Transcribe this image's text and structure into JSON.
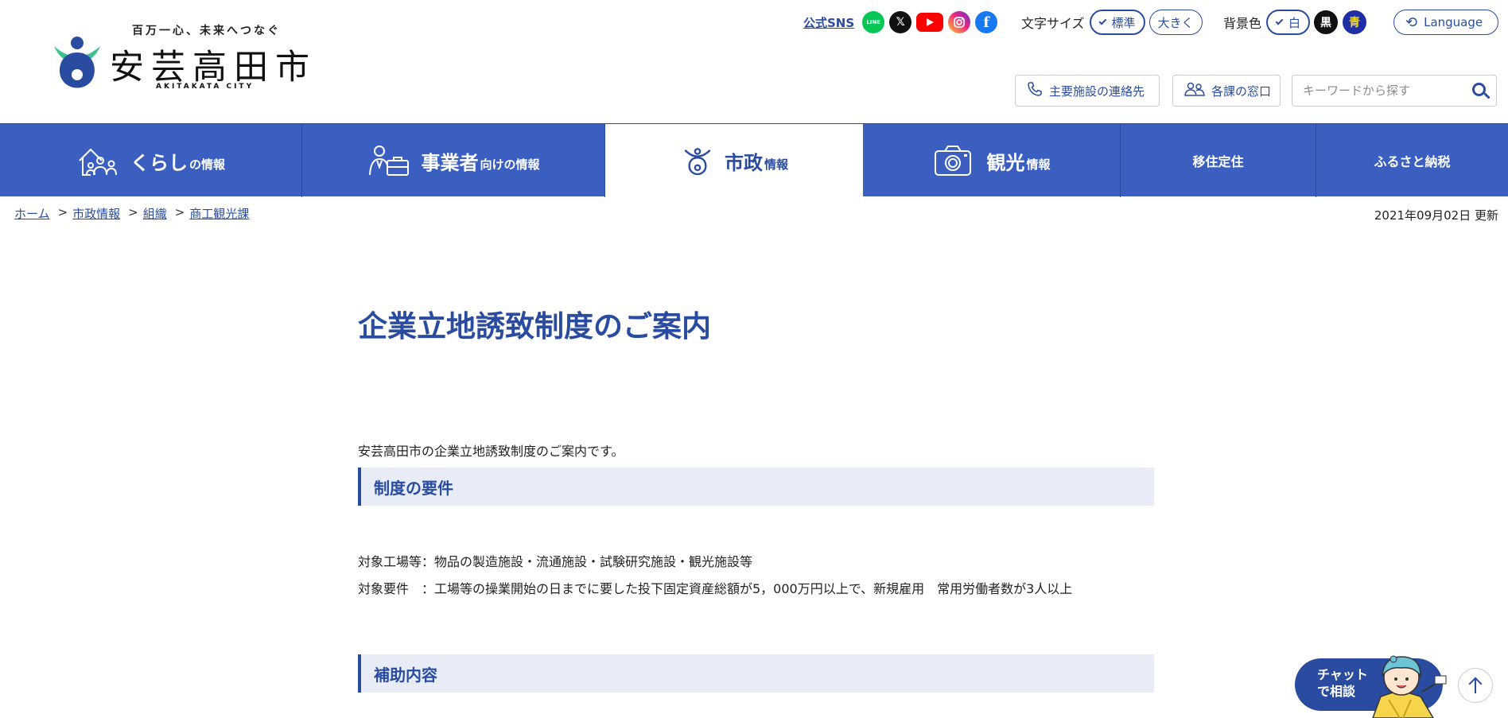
{
  "header": {
    "tagline": "百万一心、未来へつなぐ",
    "city_name": "安芸高田市",
    "city_name_en": "AKITAKATA CITY",
    "sns_label": "公式SNS",
    "sns_icons": [
      "line-icon",
      "x-icon",
      "youtube-icon",
      "instagram-icon",
      "facebook-icon"
    ],
    "line_text": "LINE",
    "x_text": "𝕏",
    "fb_text": "f",
    "font_size_label": "文字サイズ",
    "font_size_standard": "標準",
    "font_size_large": "大きく",
    "bg_color_label": "背景色",
    "bg_white": "白",
    "bg_black": "黒",
    "bg_blue": "青",
    "language_label": "Language",
    "contacts_label": "主要施設の連絡先",
    "windows_label": "各課の窓口",
    "search_placeholder": "キーワードから探す"
  },
  "nav": {
    "kurashi_big": "くらし",
    "kurashi_small": "の情報",
    "jigyousha_big": "事業者",
    "jigyousha_small": "向けの情報",
    "shisei_big": "市政",
    "shisei_small": "情報",
    "kankou_big": "観光",
    "kankou_small": "情報",
    "ijuu": "移住定住",
    "furusato": "ふるさと納税"
  },
  "breadcrumb": {
    "items": [
      "ホーム",
      "市政情報",
      "組織",
      "商工観光課"
    ],
    "separator": ">"
  },
  "updated": "2021年09月02日 更新",
  "content": {
    "title": "企業立地誘致制度のご案内",
    "lead": "安芸高田市の企業立地誘致制度のご案内です。",
    "section1_heading": "制度の要件",
    "req_line1": "対象工場等：物品の製造施設・流通施設・試験研究施設・観光施設等",
    "req_line2": "対象要件　：工場等の操業開始の日までに要した投下固定資産総額が5，000万円以上で、新規雇用　常用労働者数が3人以上",
    "section2_heading": "補助内容"
  },
  "floating": {
    "chat_line1": "チャット",
    "chat_line2": "で相談"
  },
  "colors": {
    "brand_blue": "#2a4ca0",
    "nav_blue": "#3a5fc0",
    "section_bg": "#e8ecf7",
    "logo_green": "#3ec08f"
  }
}
